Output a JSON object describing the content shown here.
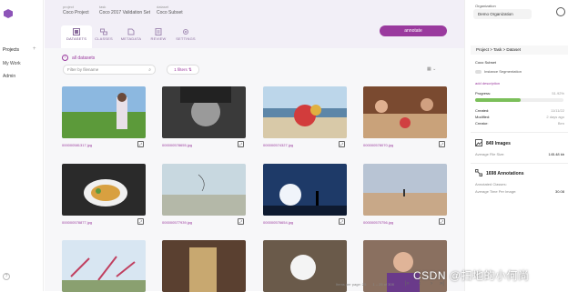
{
  "nav": {
    "projects": "Projects",
    "my_work": "My Work",
    "admin": "Admin",
    "plus": "+"
  },
  "breadcrumb": [
    {
      "label": "project",
      "value": "Coco Project"
    },
    {
      "label": "task",
      "value": "Coco 2017 Validation Set"
    },
    {
      "label": "dataset",
      "value": "Coco Subset"
    }
  ],
  "tabs": [
    {
      "label": "DATASETS",
      "icon": "datasets-icon"
    },
    {
      "label": "CLASSES",
      "icon": "classes-icon"
    },
    {
      "label": "METADATA",
      "icon": "metadata-icon"
    },
    {
      "label": "REVIEW",
      "icon": "review-icon"
    },
    {
      "label": "SETTINGS",
      "icon": "settings-icon"
    }
  ],
  "annotate_label": "annotate",
  "all_datasets": "all datasets",
  "filter": {
    "placeholder": "Filter by filename",
    "filters_label": "1 filters"
  },
  "images": [
    {
      "file": "000000581317.jpg",
      "scene": "grass"
    },
    {
      "file": "000000578655.jpg",
      "scene": "bw"
    },
    {
      "file": "000000574327.jpg",
      "scene": "beach"
    },
    {
      "file": "000000578070.jpg",
      "scene": "dinner"
    },
    {
      "file": "000000578877.jpg",
      "scene": "food"
    },
    {
      "file": "000000577939.jpg",
      "scene": "kite"
    },
    {
      "file": "000000576654.jpg",
      "scene": "sunset"
    },
    {
      "file": "000000570756.jpg",
      "scene": "sand"
    },
    {
      "file": "",
      "scene": "kites"
    },
    {
      "file": "",
      "scene": "drink"
    },
    {
      "file": "",
      "scene": "bear"
    },
    {
      "file": "",
      "scene": "face"
    }
  ],
  "footer": {
    "items_per_page": "Items per page: 25",
    "range": "1 – 25 of 308"
  },
  "pagination": {
    "first": "|«",
    "prev": "‹",
    "next": "›",
    "last": "»|"
  },
  "right": {
    "org_label": "Organization",
    "org_value": "Demo Organization",
    "project_task_dataset": "Project > Task > Dataset",
    "dataset_name": "Coco Subset",
    "instance_seg": "Instance Segmentation",
    "add_description": "add description",
    "progress_label": "Progress:",
    "progress_value": "51.92%",
    "progress": 0.5192,
    "created_label": "Created:",
    "created_value": "11/11/22",
    "modified_label": "Modified:",
    "modified_value": "2 days ago",
    "creator_label": "Creator:",
    "creator_value": "Ben",
    "images_count": "849 Images",
    "avg_file_size_label": "Average File Size:",
    "avg_file_size": "145.48 kb",
    "annotations_count": "1698 Annotations",
    "annotated_classes_label": "Annotated Classes:",
    "avg_time_label": "Average Time Per Image:",
    "avg_time": "30.08"
  },
  "watermark": "CSDN @扫地的小何尚",
  "colors": {
    "accent": "#9a3a9e",
    "progress": "#7bbf5a"
  }
}
